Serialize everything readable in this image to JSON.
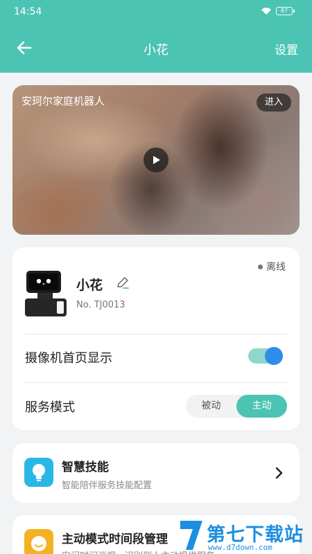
{
  "status_bar": {
    "time": "14:54",
    "battery": "87"
  },
  "nav": {
    "title": "小花",
    "settings_label": "设置"
  },
  "video": {
    "title": "安珂尔家庭机器人",
    "enter_label": "进入"
  },
  "robot": {
    "status": "离线",
    "name": "小花",
    "number": "No. TJ0013",
    "camera_label": "摄像机首页显示",
    "camera_toggle_on": true,
    "mode_label": "服务模式",
    "mode_options": [
      "被动",
      "主动"
    ],
    "mode_selected": "主动"
  },
  "skills": {
    "title": "智慧技能",
    "subtitle": "智能陪伴服务技能配置"
  },
  "time_card": {
    "title": "主动模式时间段管理",
    "subtitle": "安闲时间巡视，识别到人主动提供服务"
  },
  "watermark": {
    "name": "第七下载站",
    "url": "www.d7down.com"
  },
  "colors": {
    "accent": "#4cc4b3",
    "toggle_knob": "#2c8ee8",
    "skill_icon": "#29b7e6",
    "time_icon": "#f4b221"
  }
}
